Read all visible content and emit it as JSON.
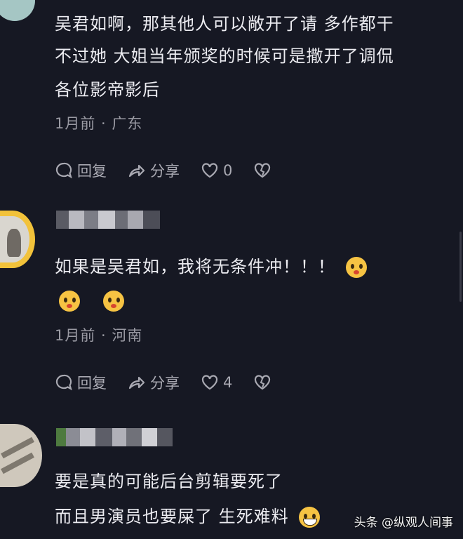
{
  "comments": [
    {
      "lines": [
        "吴君如啊，那其他人可以敞开了请 多作都干",
        "不过她 大姐当年颁奖的时候可是撒开了调侃",
        "各位影帝影后"
      ],
      "meta": "1月前 · 广东",
      "reply": "回复",
      "share": "分享",
      "likes": "0"
    },
    {
      "lines": [
        "如果是吴君如，我将无条件冲！！！"
      ],
      "meta": "1月前 · 河南",
      "reply": "回复",
      "share": "分享",
      "likes": "4"
    },
    {
      "lines": [
        "要是真的可能后台剪辑要死了",
        " 而且男演员也要屎了  生死难料"
      ]
    }
  ],
  "watermark": "头条 @纵观人间事"
}
